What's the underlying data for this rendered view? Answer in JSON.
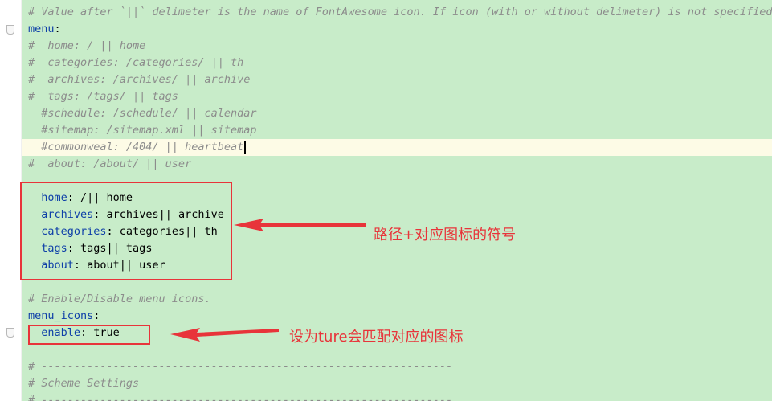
{
  "editor": {
    "lines": [
      {
        "text": "# Value after `||` delimeter is the name of FontAwesome icon. If icon (with or without delimeter) is not specified,",
        "kind": "comment"
      },
      {
        "key": "menu",
        "rest": ":",
        "kind": "key"
      },
      {
        "text": "#  home: / || home",
        "kind": "comment"
      },
      {
        "text": "#  categories: /categories/ || th",
        "kind": "comment"
      },
      {
        "text": "#  archives: /archives/ || archive",
        "kind": "comment"
      },
      {
        "text": "#  tags: /tags/ || tags",
        "kind": "comment"
      },
      {
        "text": "  #schedule: /schedule/ || calendar",
        "kind": "comment"
      },
      {
        "text": "  #sitemap: /sitemap.xml || sitemap",
        "kind": "comment"
      },
      {
        "text": "  #commonweal: /404/ || heartbeat",
        "kind": "comment",
        "current": true
      },
      {
        "text": "#  about: /about/ || user",
        "kind": "comment"
      },
      {
        "text": "",
        "kind": "blank"
      },
      {
        "indent": "  ",
        "key": "home",
        "rest": ": /|| home",
        "kind": "key"
      },
      {
        "indent": "  ",
        "key": "archives",
        "rest": ": archives|| archive",
        "kind": "key"
      },
      {
        "indent": "  ",
        "key": "categories",
        "rest": ": categories|| th",
        "kind": "key"
      },
      {
        "indent": "  ",
        "key": "tags",
        "rest": ": tags|| tags",
        "kind": "key"
      },
      {
        "indent": "  ",
        "key": "about",
        "rest": ": about|| user",
        "kind": "key"
      },
      {
        "text": "",
        "kind": "blank"
      },
      {
        "text": "# Enable/Disable menu icons.",
        "kind": "comment"
      },
      {
        "key": "menu_icons",
        "rest": ":",
        "kind": "key"
      },
      {
        "indent": "  ",
        "key": "enable",
        "rest": ": true",
        "kind": "key"
      },
      {
        "text": "",
        "kind": "blank"
      },
      {
        "text": "# ---------------------------------------------------------------",
        "kind": "comment"
      },
      {
        "text": "# Scheme Settings",
        "kind": "comment"
      },
      {
        "text": "# ---------------------------------------------------------------",
        "kind": "comment"
      }
    ]
  },
  "annotations": {
    "menu_note": "路径+对应图标的符号",
    "icons_note": "设为ture会匹配对应的图标"
  },
  "colors": {
    "code_background": "#c8ecc9",
    "current_line": "#fdfbe6",
    "comment": "#8c8c8c",
    "key": "#0e3fa8",
    "annotation": "#e8343a"
  }
}
